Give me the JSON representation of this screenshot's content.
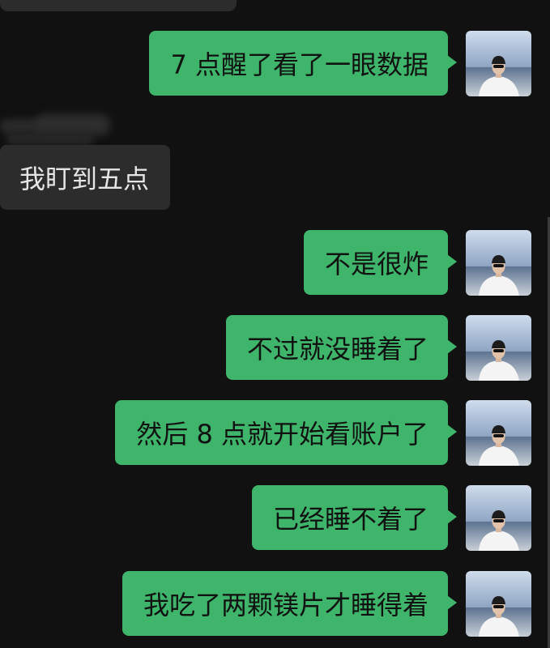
{
  "chat": {
    "incoming_message": "我盯到五点",
    "outgoing_messages": [
      "7 点醒了看了一眼数据",
      "不是很炸",
      "不过就没睡着了",
      "然后 8 点就开始看账户了",
      "已经睡不着了",
      "我吃了两颗镁片才睡得着"
    ]
  },
  "colors": {
    "background": "#111111",
    "outgoing_bubble": "#3eb56a",
    "incoming_bubble": "#2c2c2c"
  },
  "icons": {
    "avatar": "avatar-photo"
  }
}
